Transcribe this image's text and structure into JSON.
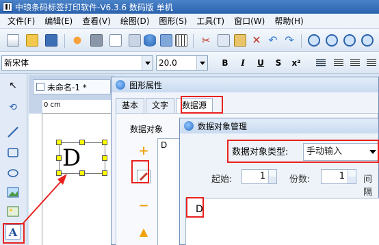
{
  "window": {
    "title": "中琅条码标签打印软件-V6.3.6 数码版 单机"
  },
  "menu": [
    "文件(F)",
    "编辑(E)",
    "查看(V)",
    "绘图(D)",
    "图形(S)",
    "工具(T)",
    "窗口(W)",
    "帮助(H)"
  ],
  "format": {
    "font": "新宋体",
    "size": "20.0",
    "bold": "B",
    "italic": "I",
    "underline": "U",
    "strike": "S"
  },
  "document": {
    "tab": "未命名-1 *",
    "ruler_zero": "0 cm",
    "label_text": "D"
  },
  "prop_dialog": {
    "title": "图形属性",
    "tabs": [
      "基本",
      "文字",
      "数据源"
    ],
    "objects_label": "数据对象",
    "objects": [
      "D"
    ]
  },
  "manager": {
    "title": "数据对象管理",
    "type_label": "数据对象类型:",
    "type_value": "手动输入",
    "start_label": "起始:",
    "start_value": "1",
    "copies_label": "份数:",
    "copies_value": "1",
    "interval_label": "间隔",
    "data_value": "D"
  },
  "colors": {
    "highlight": "#e8211d",
    "titlebar": "#2a62ad",
    "handle": "#ffff00"
  }
}
